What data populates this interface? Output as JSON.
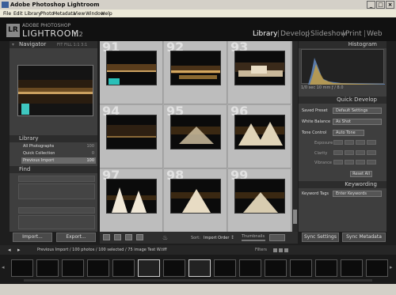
{
  "window": {
    "title": "Adobe Photoshop Lightroom"
  },
  "menu": [
    "File",
    "Edit",
    "Library",
    "Photo",
    "Metadata",
    "View",
    "Window",
    "Help"
  ],
  "brand": {
    "top": "ADOBE PHOTOSHOP",
    "main": "LIGHTROOM",
    "version": "1.2",
    "logo": "LR"
  },
  "modules": [
    "Library",
    "Develop",
    "Slideshow",
    "Print",
    "Web"
  ],
  "left": {
    "navigator": {
      "title": "Navigator",
      "options": "FIT  FILL  1:1  3:1"
    },
    "library": {
      "title": "Library",
      "items": [
        {
          "label": "All Photographs",
          "count": "100"
        },
        {
          "label": "Quick Collection",
          "count": "0"
        },
        {
          "label": "Previous Import",
          "count": "100"
        }
      ]
    },
    "find": {
      "title": "Find"
    },
    "import_label": "Import...",
    "export_label": "Export..."
  },
  "grid": {
    "numbers": [
      "91",
      "92",
      "93",
      "94",
      "95",
      "96",
      "97",
      "98",
      "99"
    ]
  },
  "right": {
    "histogram": {
      "title": "Histogram",
      "readout": "1/0 sec     10 mm     ƒ / 8.0"
    },
    "quick_develop": {
      "title": "Quick Develop",
      "saved_preset_label": "Saved Preset",
      "saved_preset_value": "Default Settings",
      "white_balance_label": "White Balance",
      "white_balance_value": "As Shot",
      "tone_control_label": "Tone Control",
      "tone_control_value": "Auto Tone",
      "exposure_label": "Exposure",
      "clarity_label": "Clarity",
      "vibrance_label": "Vibrance",
      "reset_label": "Reset All"
    },
    "keywording": {
      "title": "Keywording",
      "tags_label": "Keyword Tags",
      "tags_value": "Enter Keywords"
    },
    "sync_settings_label": "Sync Settings",
    "sync_metadata_label": "Sync Metadata"
  },
  "toolbar": {
    "sort_label": "Sort:",
    "sort_value": "Import Order",
    "thumbs_label": "Thumbnails"
  },
  "filmstrip": {
    "path": "Previous Import / 100 photos / 100 selected / 75 image Test W.tiff",
    "filters_label": "Filters"
  },
  "icons": [
    "back-arrow-icon",
    "forward-arrow-icon",
    "grid-view-icon",
    "loupe-view-icon",
    "compare-view-icon",
    "survey-view-icon",
    "spray-can-icon",
    "sort-direction-icon"
  ]
}
